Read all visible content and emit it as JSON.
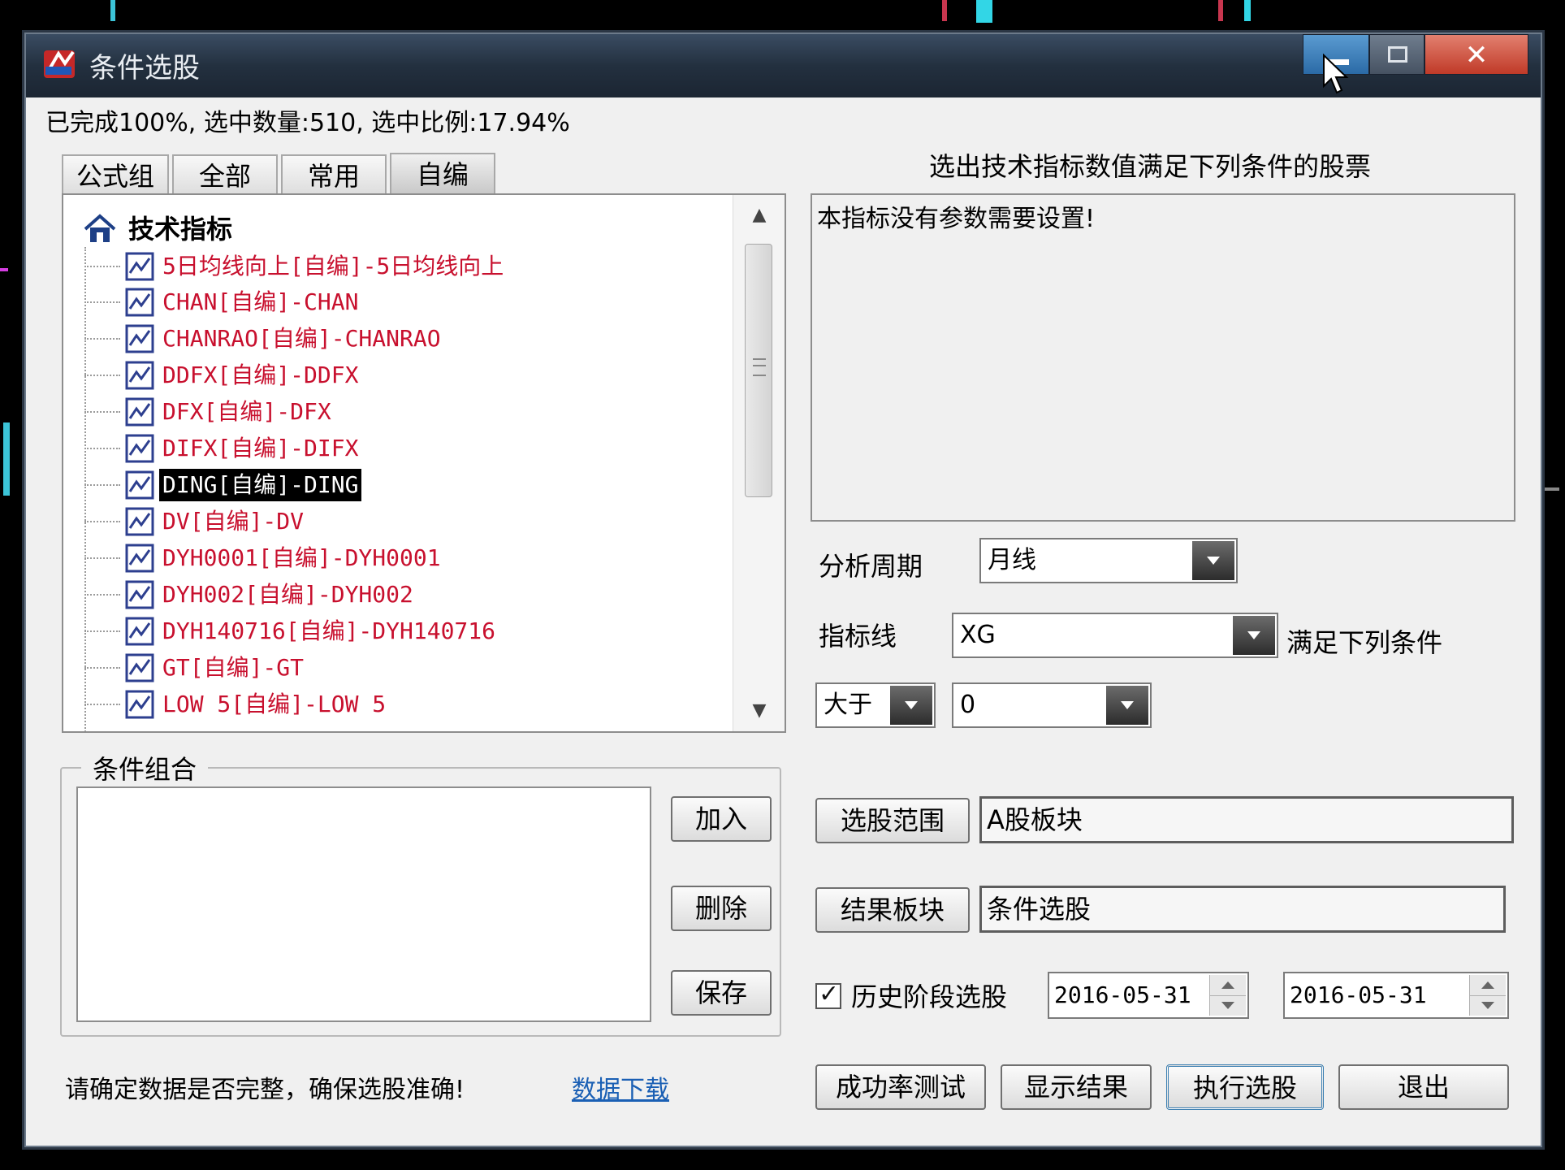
{
  "window": {
    "title": "条件选股"
  },
  "status": {
    "progress_text": "已完成100%, 选中数量:510, 选中比例:17.94%"
  },
  "tabs": [
    {
      "label": "公式组"
    },
    {
      "label": "全部"
    },
    {
      "label": "常用"
    },
    {
      "label": "自编",
      "active": true
    }
  ],
  "tree": {
    "root": "技术指标",
    "items": [
      {
        "label": "5日均线向上[自编]-5日均线向上"
      },
      {
        "label": "CHAN[自编]-CHAN"
      },
      {
        "label": "CHANRAO[自编]-CHANRAO"
      },
      {
        "label": "DDFX[自编]-DDFX"
      },
      {
        "label": "DFX[自编]-DFX"
      },
      {
        "label": "DIFX[自编]-DIFX"
      },
      {
        "label": "DING[自编]-DING",
        "selected": true
      },
      {
        "label": "DV[自编]-DV"
      },
      {
        "label": "DYH0001[自编]-DYH0001"
      },
      {
        "label": "DYH002[自编]-DYH002"
      },
      {
        "label": "DYH140716[自编]-DYH140716"
      },
      {
        "label": "GT[自编]-GT"
      },
      {
        "label": "LOW 5[自编]-LOW 5"
      }
    ]
  },
  "condition_group": {
    "title": "条件组合",
    "add_label": "加入",
    "delete_label": "删除",
    "save_label": "保存"
  },
  "right": {
    "caption": "选出技术指标数值满足下列条件的股票",
    "param_text": "本指标没有参数需要设置!",
    "period_label": "分析周期",
    "period_value": "月线",
    "indicator_label": "指标线",
    "indicator_value": "XG",
    "indicator_suffix": "满足下列条件",
    "operator_value": "大于",
    "threshold_value": "0",
    "range_button": "选股范围",
    "range_value": "A股板块",
    "result_button": "结果板块",
    "result_value": "条件选股",
    "history_label": "历史阶段选股",
    "history_checked": true,
    "date_from": "2016-05-31",
    "date_to": "2016-05-31"
  },
  "bottom": {
    "note": "请确定数据是否完整，确保选股准确!",
    "link": "数据下载",
    "buttons": {
      "success_test": "成功率测试",
      "show_results": "显示结果",
      "execute": "执行选股",
      "exit": "退出"
    }
  },
  "colors": {
    "item_text": "#c8102e",
    "root_text": "#16215e",
    "link": "#1a5fb4"
  }
}
